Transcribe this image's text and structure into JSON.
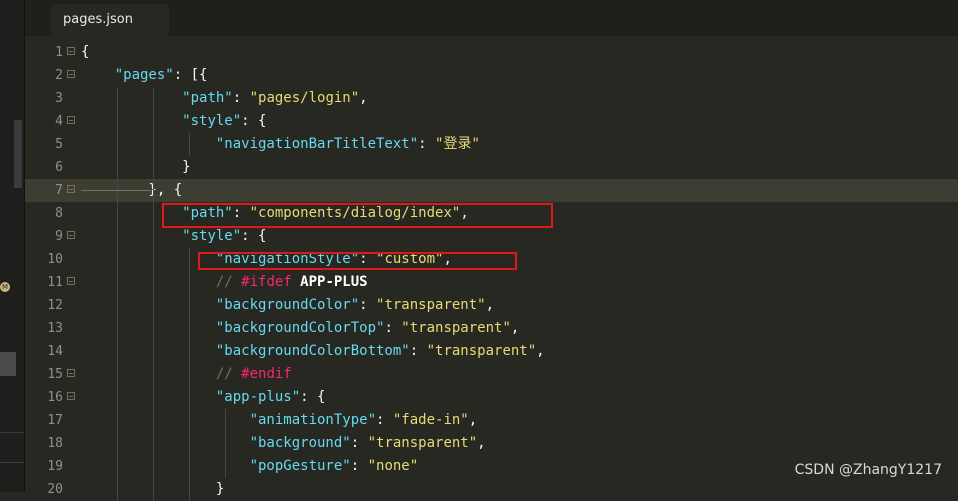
{
  "tab": {
    "filename": "pages.json"
  },
  "sidebar": {
    "badge_letter": "M"
  },
  "lines": [
    {
      "n": "1",
      "fold": true,
      "code": [
        {
          "t": "p",
          "v": "{"
        }
      ]
    },
    {
      "n": "2",
      "fold": true,
      "code": [
        {
          "t": "p",
          "v": "    "
        },
        {
          "t": "k",
          "v": "\"pages\""
        },
        {
          "t": "p",
          "v": ": [{"
        }
      ]
    },
    {
      "n": "3",
      "fold": false,
      "code": [
        {
          "t": "p",
          "v": "            "
        },
        {
          "t": "k",
          "v": "\"path\""
        },
        {
          "t": "p",
          "v": ": "
        },
        {
          "t": "s",
          "v": "\"pages/login\""
        },
        {
          "t": "p",
          "v": ","
        }
      ]
    },
    {
      "n": "4",
      "fold": true,
      "code": [
        {
          "t": "p",
          "v": "            "
        },
        {
          "t": "k",
          "v": "\"style\""
        },
        {
          "t": "p",
          "v": ": {"
        }
      ]
    },
    {
      "n": "5",
      "fold": false,
      "code": [
        {
          "t": "p",
          "v": "                "
        },
        {
          "t": "k",
          "v": "\"navigationBarTitleText\""
        },
        {
          "t": "p",
          "v": ": "
        },
        {
          "t": "s",
          "v": "\"登录\""
        }
      ]
    },
    {
      "n": "6",
      "fold": false,
      "code": [
        {
          "t": "p",
          "v": "            }"
        }
      ]
    },
    {
      "n": "7",
      "fold": true,
      "cur": true,
      "code": [
        {
          "t": "p",
          "v": "        }, {"
        }
      ]
    },
    {
      "n": "8",
      "fold": false,
      "code": [
        {
          "t": "p",
          "v": "            "
        },
        {
          "t": "k",
          "v": "\"path\""
        },
        {
          "t": "p",
          "v": ": "
        },
        {
          "t": "s",
          "v": "\"components/dialog/index\""
        },
        {
          "t": "p",
          "v": ","
        }
      ]
    },
    {
      "n": "9",
      "fold": true,
      "code": [
        {
          "t": "p",
          "v": "            "
        },
        {
          "t": "k",
          "v": "\"style\""
        },
        {
          "t": "p",
          "v": ": {"
        }
      ]
    },
    {
      "n": "10",
      "fold": false,
      "code": [
        {
          "t": "p",
          "v": "                "
        },
        {
          "t": "k",
          "v": "\"navigationStyle\""
        },
        {
          "t": "p",
          "v": ": "
        },
        {
          "t": "s",
          "v": "\"custom\""
        },
        {
          "t": "p",
          "v": ","
        }
      ]
    },
    {
      "n": "11",
      "fold": true,
      "code": [
        {
          "t": "p",
          "v": "                "
        },
        {
          "t": "c",
          "v": "// "
        },
        {
          "t": "d",
          "v": "#ifdef"
        },
        {
          "t": "w",
          "v": " APP-PLUS"
        }
      ]
    },
    {
      "n": "12",
      "fold": false,
      "code": [
        {
          "t": "p",
          "v": "                "
        },
        {
          "t": "k",
          "v": "\"backgroundColor\""
        },
        {
          "t": "p",
          "v": ": "
        },
        {
          "t": "s",
          "v": "\"transparent\""
        },
        {
          "t": "p",
          "v": ","
        }
      ]
    },
    {
      "n": "13",
      "fold": false,
      "code": [
        {
          "t": "p",
          "v": "                "
        },
        {
          "t": "k",
          "v": "\"backgroundColorTop\""
        },
        {
          "t": "p",
          "v": ": "
        },
        {
          "t": "s",
          "v": "\"transparent\""
        },
        {
          "t": "p",
          "v": ","
        }
      ]
    },
    {
      "n": "14",
      "fold": false,
      "code": [
        {
          "t": "p",
          "v": "                "
        },
        {
          "t": "k",
          "v": "\"backgroundColorBottom\""
        },
        {
          "t": "p",
          "v": ": "
        },
        {
          "t": "s",
          "v": "\"transparent\""
        },
        {
          "t": "p",
          "v": ","
        }
      ]
    },
    {
      "n": "15",
      "fold": true,
      "code": [
        {
          "t": "p",
          "v": "                "
        },
        {
          "t": "c",
          "v": "// "
        },
        {
          "t": "d",
          "v": "#endif"
        }
      ]
    },
    {
      "n": "16",
      "fold": true,
      "code": [
        {
          "t": "p",
          "v": "                "
        },
        {
          "t": "k",
          "v": "\"app-plus\""
        },
        {
          "t": "p",
          "v": ": {"
        }
      ]
    },
    {
      "n": "17",
      "fold": false,
      "code": [
        {
          "t": "p",
          "v": "                    "
        },
        {
          "t": "k",
          "v": "\"animationType\""
        },
        {
          "t": "p",
          "v": ": "
        },
        {
          "t": "s",
          "v": "\"fade-in\""
        },
        {
          "t": "p",
          "v": ","
        }
      ]
    },
    {
      "n": "18",
      "fold": false,
      "code": [
        {
          "t": "p",
          "v": "                    "
        },
        {
          "t": "k",
          "v": "\"background\""
        },
        {
          "t": "p",
          "v": ": "
        },
        {
          "t": "s",
          "v": "\"transparent\""
        },
        {
          "t": "p",
          "v": ","
        }
      ]
    },
    {
      "n": "19",
      "fold": false,
      "code": [
        {
          "t": "p",
          "v": "                    "
        },
        {
          "t": "k",
          "v": "\"popGesture\""
        },
        {
          "t": "p",
          "v": ": "
        },
        {
          "t": "s",
          "v": "\"none\""
        }
      ]
    },
    {
      "n": "20",
      "fold": false,
      "code": [
        {
          "t": "p",
          "v": "                }"
        }
      ]
    }
  ],
  "watermark": "CSDN @ZhangY1217",
  "colors": {
    "keyword": "#66d9ef",
    "string": "#e6db74",
    "comment": "#75715e",
    "directive": "#f92672",
    "highlight_box": "#e01818",
    "background": "#272822"
  }
}
